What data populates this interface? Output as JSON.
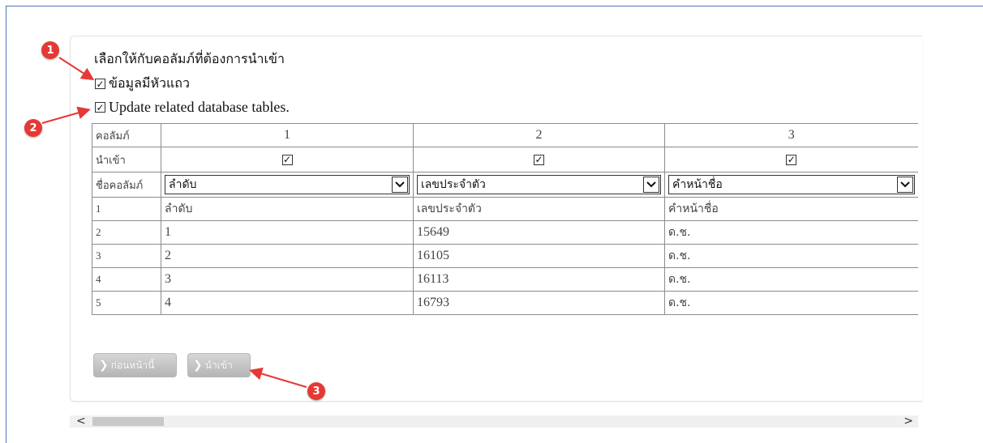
{
  "heading": "เลือกให้กับคอลัมภ์ที่ต้องการนำเข้า",
  "options": [
    {
      "label": "ข้อมูลมีหัวแถว",
      "checked": true
    },
    {
      "label": "Update related database tables.",
      "checked": true
    }
  ],
  "table": {
    "row_labels": {
      "column": "คอลัมภ์",
      "import": "นำเข้า",
      "column_name": "ชื่อคอลัมภ์"
    },
    "column_numbers": [
      "1",
      "2",
      "3"
    ],
    "import_checked": [
      true,
      true,
      true
    ],
    "column_selects": [
      "ลำดับ",
      "เลขประจำตัว",
      "คำหน้าชื่อ"
    ],
    "rows": [
      [
        "1",
        "ลำดับ",
        "เลขประจำตัว",
        "คำหน้าชื่อ"
      ],
      [
        "2",
        "1",
        "15649",
        "ด.ช."
      ],
      [
        "3",
        "2",
        "16105",
        "ด.ช."
      ],
      [
        "4",
        "3",
        "16113",
        "ด.ช."
      ],
      [
        "5",
        "4",
        "16793",
        "ด.ช."
      ]
    ]
  },
  "buttons": {
    "back": "ก่อนหน้านี้",
    "import": "นำเข้า"
  },
  "callouts": [
    "1",
    "2",
    "3"
  ],
  "icons": {
    "check": "✓",
    "dropdown": "✓",
    "chevron": "▶",
    "scroll_left": "‹",
    "scroll_right": "›"
  },
  "colors": {
    "callout": "#e53935",
    "frame": "#4a76b8"
  }
}
